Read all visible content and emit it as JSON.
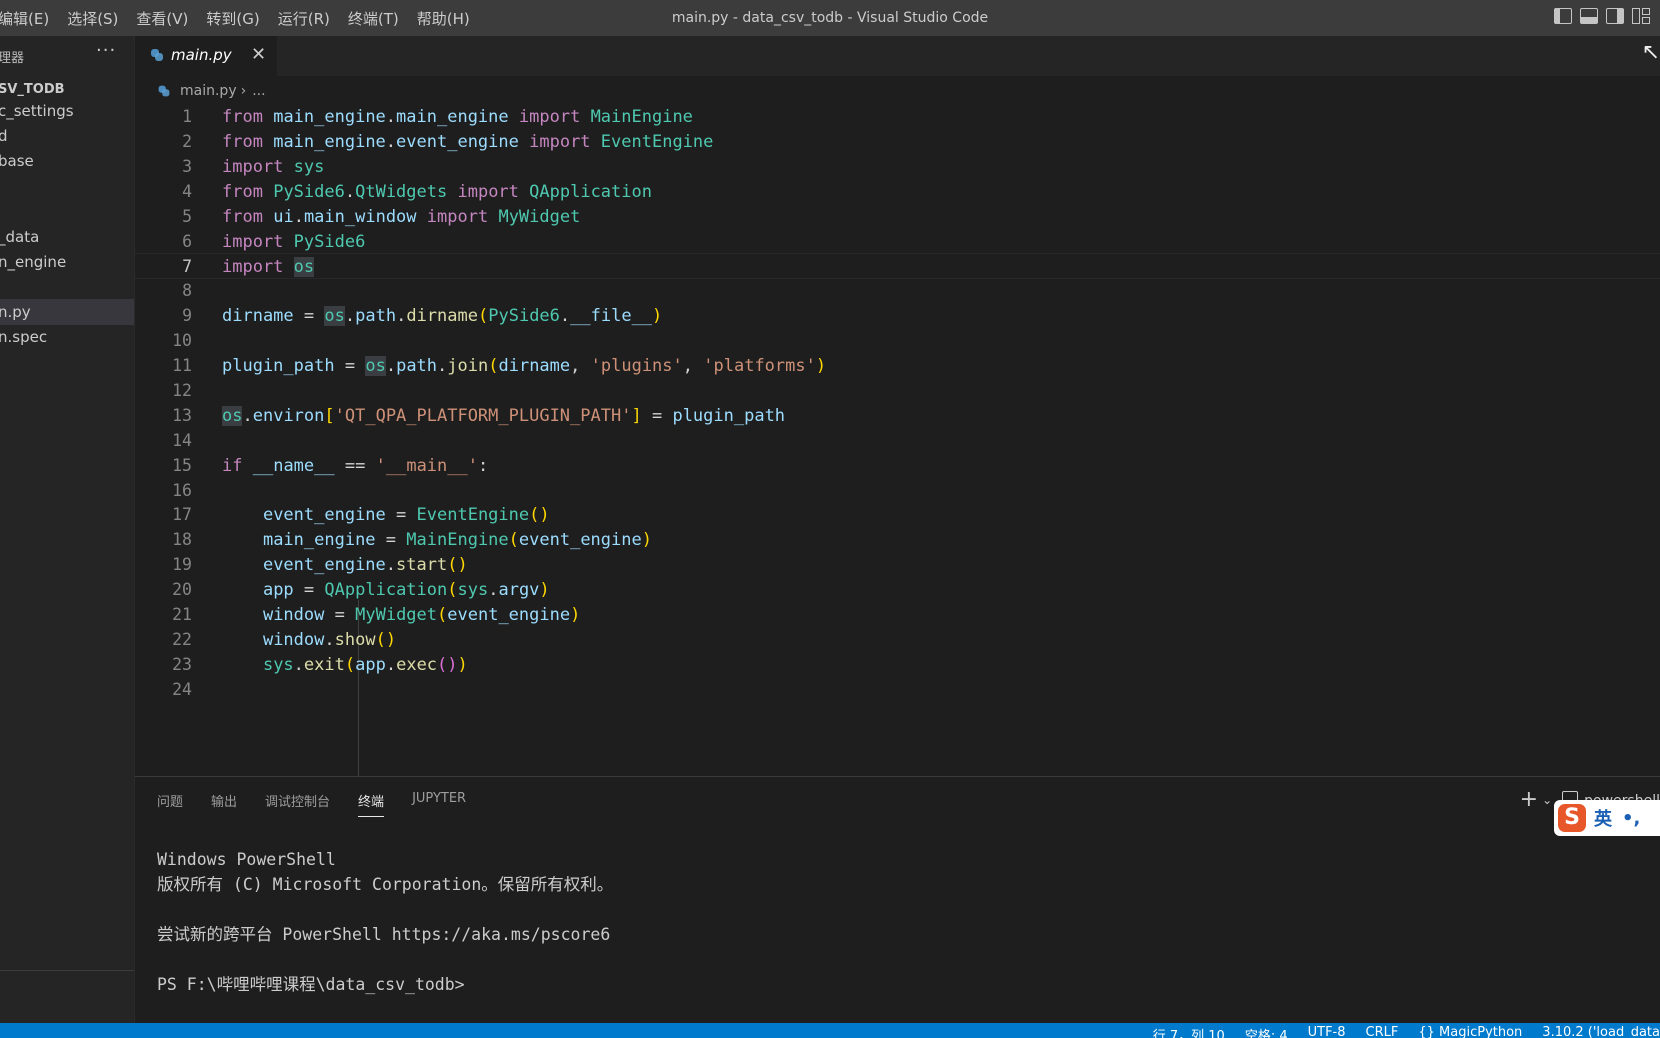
{
  "titlebar": {
    "menu": [
      "编辑(E)",
      "选择(S)",
      "查看(V)",
      "转到(G)",
      "运行(R)",
      "终端(T)",
      "帮助(H)"
    ],
    "title": "main.py - data_csv_todb - Visual Studio Code"
  },
  "sidebar": {
    "title": "理器",
    "more": "···",
    "root": "SV_TODB",
    "items": [
      "c_settings",
      "d",
      "base",
      "_data",
      "n_engine",
      "n.py",
      "n.spec"
    ],
    "selected_index": 5
  },
  "tab": {
    "label": "main.py",
    "close": "✕"
  },
  "breadcrumb": {
    "file": "main.py",
    "rest": "..."
  },
  "editor": {
    "active_line": 7,
    "lines": [
      "from main_engine.main_engine import MainEngine",
      "from main_engine.event_engine import EventEngine",
      "import sys",
      "from PySide6.QtWidgets import QApplication",
      "from ui.main_window import MyWidget",
      "import PySide6",
      "import os",
      "",
      "dirname = os.path.dirname(PySide6.__file__)",
      "",
      "plugin_path = os.path.join(dirname, 'plugins', 'platforms')",
      "",
      "os.environ['QT_QPA_PLATFORM_PLUGIN_PATH'] = plugin_path",
      "",
      "if __name__ == '__main__':",
      "",
      "    event_engine = EventEngine()",
      "    main_engine = MainEngine(event_engine)",
      "    event_engine.start()",
      "    app = QApplication(sys.argv)",
      "    window = MyWidget(event_engine)",
      "    window.show()",
      "    sys.exit(app.exec())",
      ""
    ]
  },
  "panel": {
    "tabs": [
      "问题",
      "输出",
      "调试控制台",
      "终端",
      "JUPYTER"
    ],
    "active_tab": 3,
    "terminal_name": "powershell",
    "terminal_lines": [
      "Windows PowerShell",
      "版权所有 (C) Microsoft Corporation。保留所有权利。",
      "",
      "尝试新的跨平台 PowerShell https://aka.ms/pscore6",
      "",
      "PS F:\\哔哩哔哩课程\\data_csv_todb>"
    ]
  },
  "ime": {
    "logo": "S",
    "mode": "英",
    "punct": "•,"
  },
  "statusbar": {
    "items": [
      "行 7，列 10",
      "空格: 4",
      "UTF-8",
      "CRLF",
      "{} MagicPython",
      "3.10.2 ('load_data"
    ]
  },
  "colors": {
    "keyword": "#c586c0",
    "identifier": "#9cdcfe",
    "class": "#4ec9b0",
    "function": "#dcdcaa",
    "string": "#ce9178",
    "statusbar": "#007acc"
  }
}
